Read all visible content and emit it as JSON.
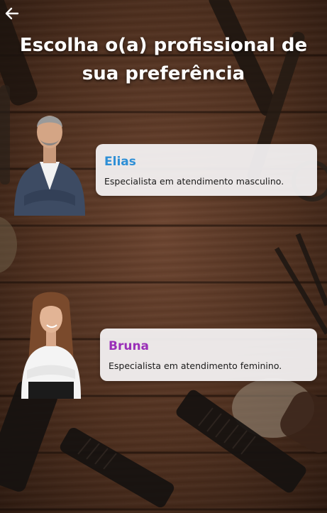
{
  "header": {
    "title": "Escolha o(a) profissional de sua preferência",
    "back_icon": "arrow-left-icon"
  },
  "professionals": [
    {
      "name": "Elias",
      "description": "Especialista em atendimento masculino.",
      "name_color": "#2e8fd6",
      "avatar": "man-in-suit-photo"
    },
    {
      "name": "Bruna",
      "description": "Especialista em atendimento feminino.",
      "name_color": "#9a2fb8",
      "avatar": "woman-in-white-shirt-photo"
    }
  ],
  "theme": {
    "background": "dark-wood-barber-tools",
    "card_bg": "#f4f2f3"
  }
}
